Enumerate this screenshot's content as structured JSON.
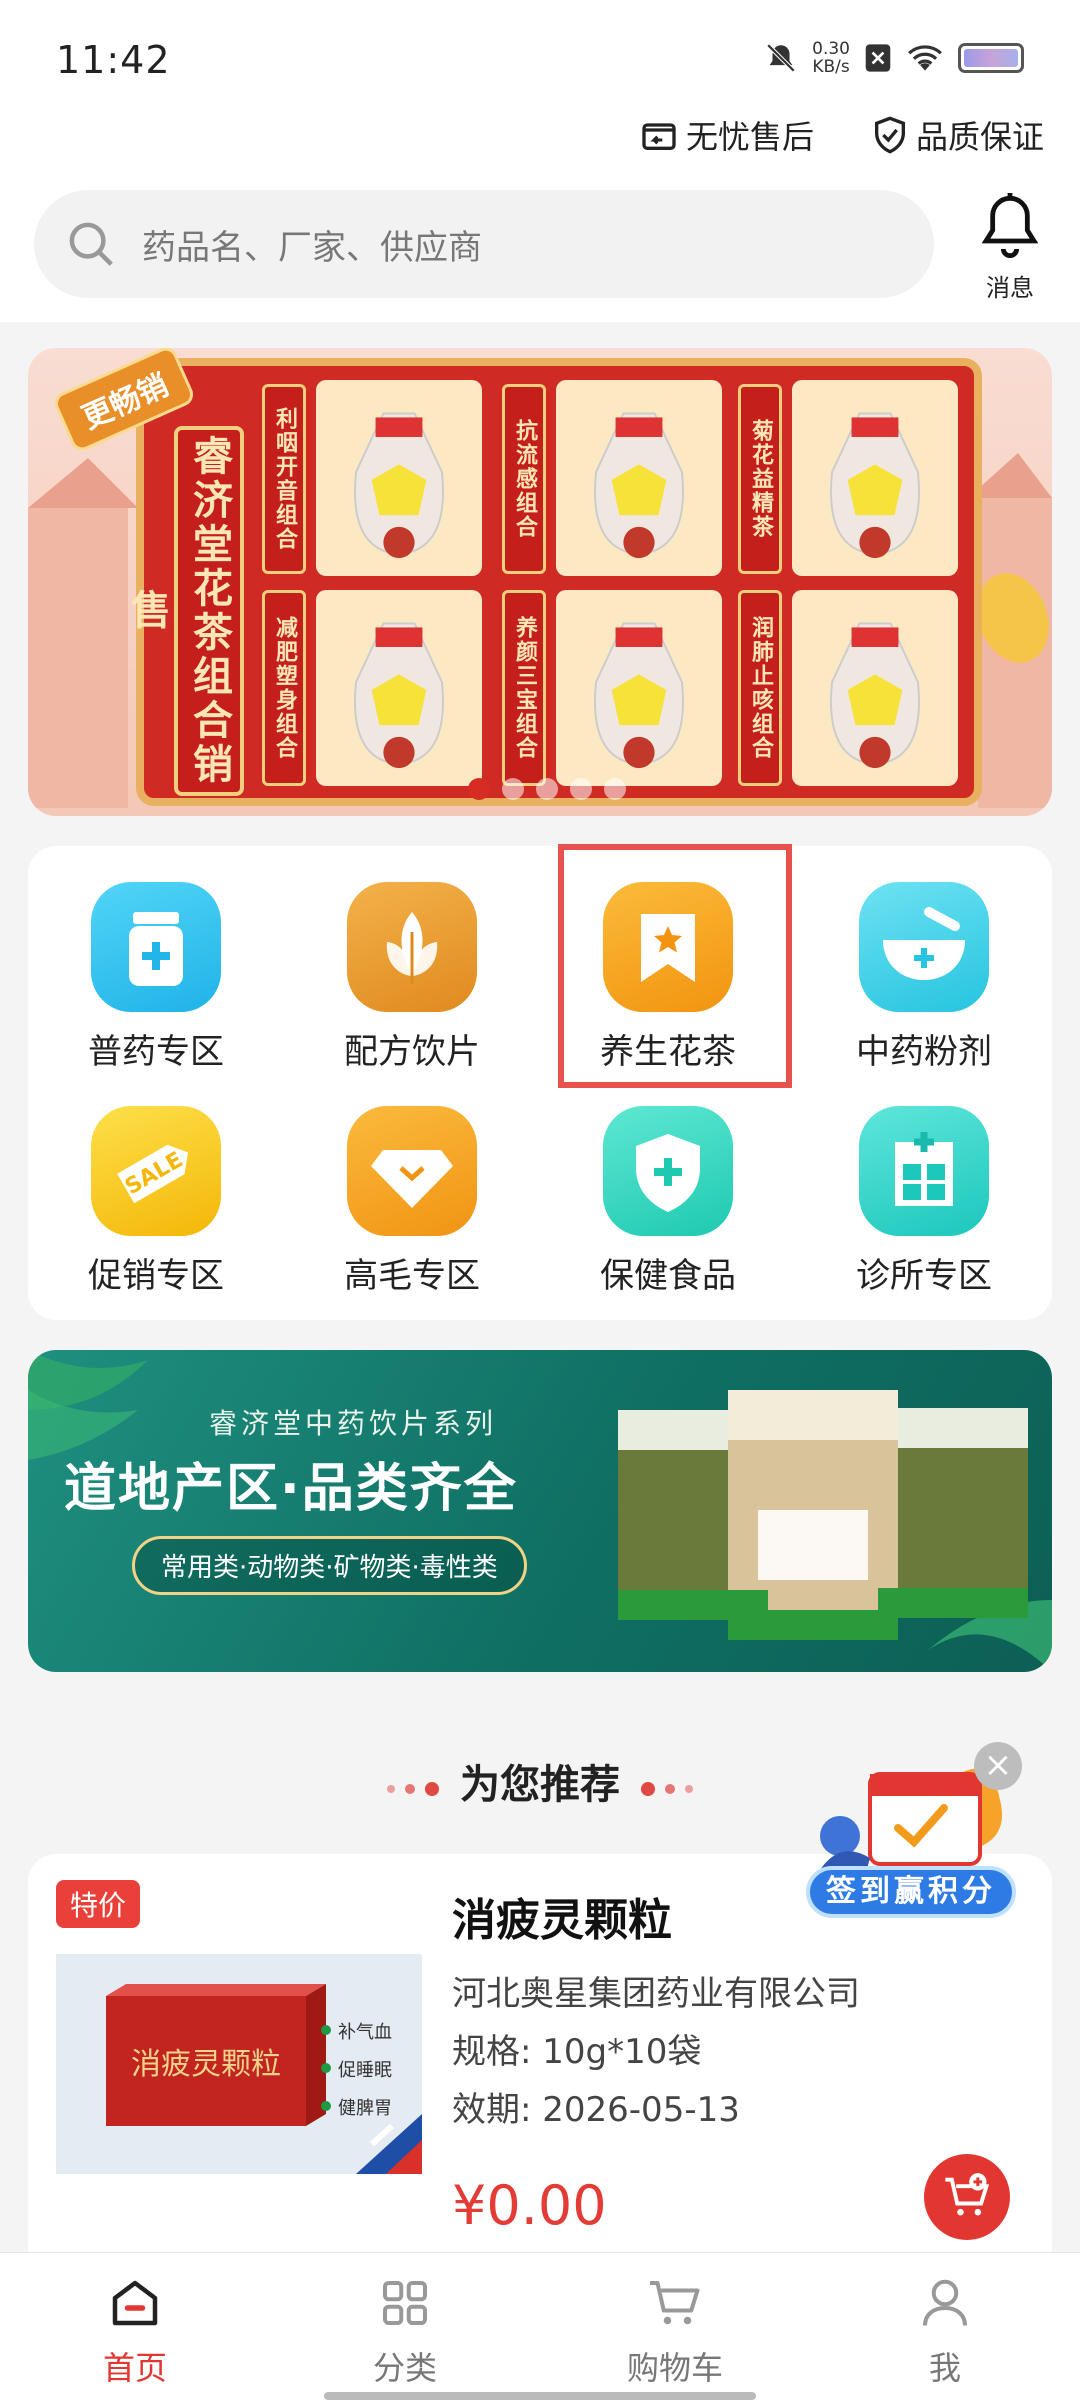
{
  "status_bar": {
    "time": "11:42",
    "net_speed": "0.30",
    "net_unit": "KB/s"
  },
  "header": {
    "guarantees": [
      "无忧售后",
      "品质保证"
    ],
    "search_placeholder": "药品名、厂家、供应商",
    "message_label": "消息"
  },
  "banner_top": {
    "tag": "更畅销",
    "title": "睿济堂花茶组合销售",
    "combos": [
      "利咽开音组合",
      "抗流感组合",
      "菊花益精茶",
      "减肥塑身组合",
      "养颜三宝组合",
      "润肺止咳组合"
    ],
    "active_slide": 1,
    "slide_count": 5
  },
  "categories": [
    {
      "label": "普药专区",
      "icon": "medicine-bottle-icon",
      "color": "#2ec5f2"
    },
    {
      "label": "配方饮片",
      "icon": "herb-leaf-icon",
      "color": "#e89a2e"
    },
    {
      "label": "养生花茶",
      "icon": "bookmark-star-icon",
      "color": "#f7a21d"
    },
    {
      "label": "中药粉剂",
      "icon": "mortar-bowl-icon",
      "color": "#38d4e8"
    },
    {
      "label": "促销专区",
      "icon": "sale-tag-icon",
      "color": "#f8c71b"
    },
    {
      "label": "高毛专区",
      "icon": "diamond-icon",
      "color": "#f6a323"
    },
    {
      "label": "保健食品",
      "icon": "shield-plus-icon",
      "color": "#2fd6bf"
    },
    {
      "label": "诊所专区",
      "icon": "clinic-icon",
      "color": "#2fd2c6"
    }
  ],
  "banner_mid": {
    "subtitle": "睿济堂中药饮片系列",
    "title": "道地产区·品类齐全",
    "pill": "常用类·动物类·矿物类·毒性类"
  },
  "recommend": {
    "heading": "为您推荐",
    "signin_label": "签到赢积分",
    "products": [
      {
        "badge": "特价",
        "name": "消疲灵颗粒",
        "maker": "河北奥星集团药业有限公司",
        "spec": "规格: 10g*10袋",
        "expiry": "效期: 2026-05-13",
        "price": "¥0.00",
        "box_title": "消疲灵颗粒",
        "benefits": [
          "补气血",
          "促睡眠",
          "健脾胃"
        ]
      }
    ]
  },
  "bottom_nav": [
    {
      "label": "首页",
      "icon": "home-icon",
      "active": true
    },
    {
      "label": "分类",
      "icon": "grid-icon",
      "active": false
    },
    {
      "label": "购物车",
      "icon": "cart-icon",
      "active": false
    },
    {
      "label": "我",
      "icon": "person-icon",
      "active": false
    }
  ],
  "colors": {
    "accent": "#e23731",
    "highlight_box": "#e8524d"
  }
}
